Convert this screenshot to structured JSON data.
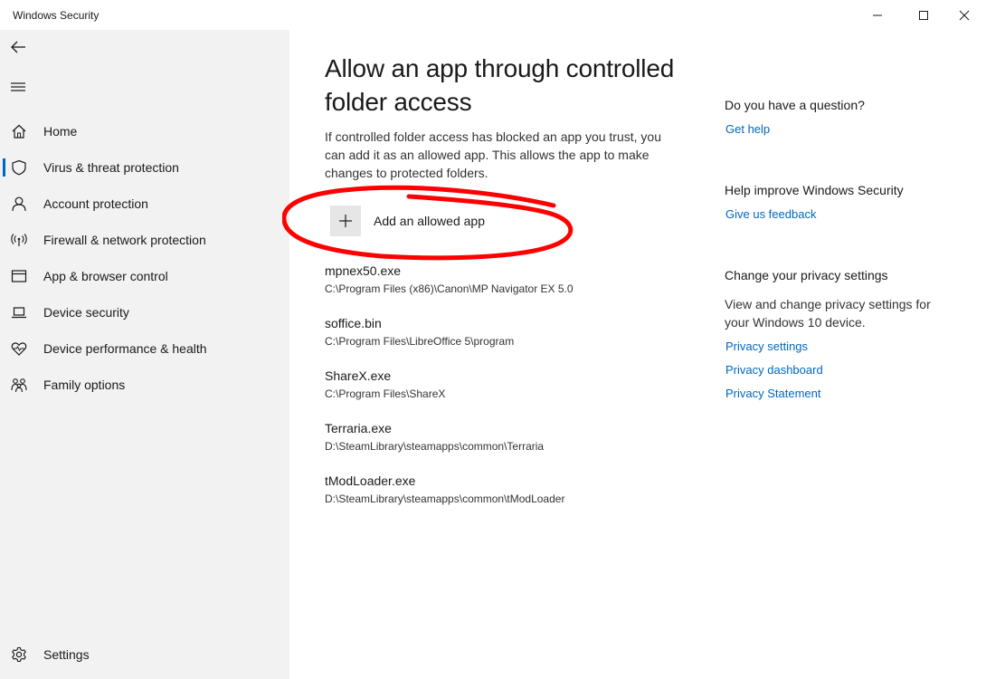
{
  "window": {
    "title": "Windows Security"
  },
  "sidebar": {
    "items": [
      {
        "label": "Home",
        "icon": "home-icon"
      },
      {
        "label": "Virus & threat protection",
        "icon": "shield-icon",
        "active": true
      },
      {
        "label": "Account protection",
        "icon": "person-icon"
      },
      {
        "label": "Firewall & network protection",
        "icon": "antenna-icon"
      },
      {
        "label": "App & browser control",
        "icon": "app-window-icon"
      },
      {
        "label": "Device security",
        "icon": "laptop-icon"
      },
      {
        "label": "Device performance & health",
        "icon": "heart-pulse-icon"
      },
      {
        "label": "Family options",
        "icon": "family-icon"
      }
    ],
    "settings_label": "Settings"
  },
  "main": {
    "title": "Allow an app through controlled folder access",
    "description": "If controlled folder access has blocked an app you trust, you can add it as an allowed app. This allows the app to make changes to protected folders.",
    "add_button_label": "Add an allowed app",
    "apps": [
      {
        "name": "mpnex50.exe",
        "path": "C:\\Program Files (x86)\\Canon\\MP Navigator EX 5.0"
      },
      {
        "name": "soffice.bin",
        "path": "C:\\Program Files\\LibreOffice 5\\program"
      },
      {
        "name": "ShareX.exe",
        "path": "C:\\Program Files\\ShareX"
      },
      {
        "name": "Terraria.exe",
        "path": "D:\\SteamLibrary\\steamapps\\common\\Terraria"
      },
      {
        "name": "tModLoader.exe",
        "path": "D:\\SteamLibrary\\steamapps\\common\\tModLoader"
      }
    ]
  },
  "side_panel": {
    "question_title": "Do you have a question?",
    "get_help": "Get help",
    "improve_title": "Help improve Windows Security",
    "feedback": "Give us feedback",
    "privacy_title": "Change your privacy settings",
    "privacy_text": "View and change privacy settings for your Windows 10 device.",
    "privacy_settings": "Privacy settings",
    "privacy_dashboard": "Privacy dashboard",
    "privacy_statement": "Privacy Statement"
  },
  "colors": {
    "accent": "#0067c0",
    "sidebar_bg": "#f2f2f2",
    "annotation": "#ff0000"
  }
}
